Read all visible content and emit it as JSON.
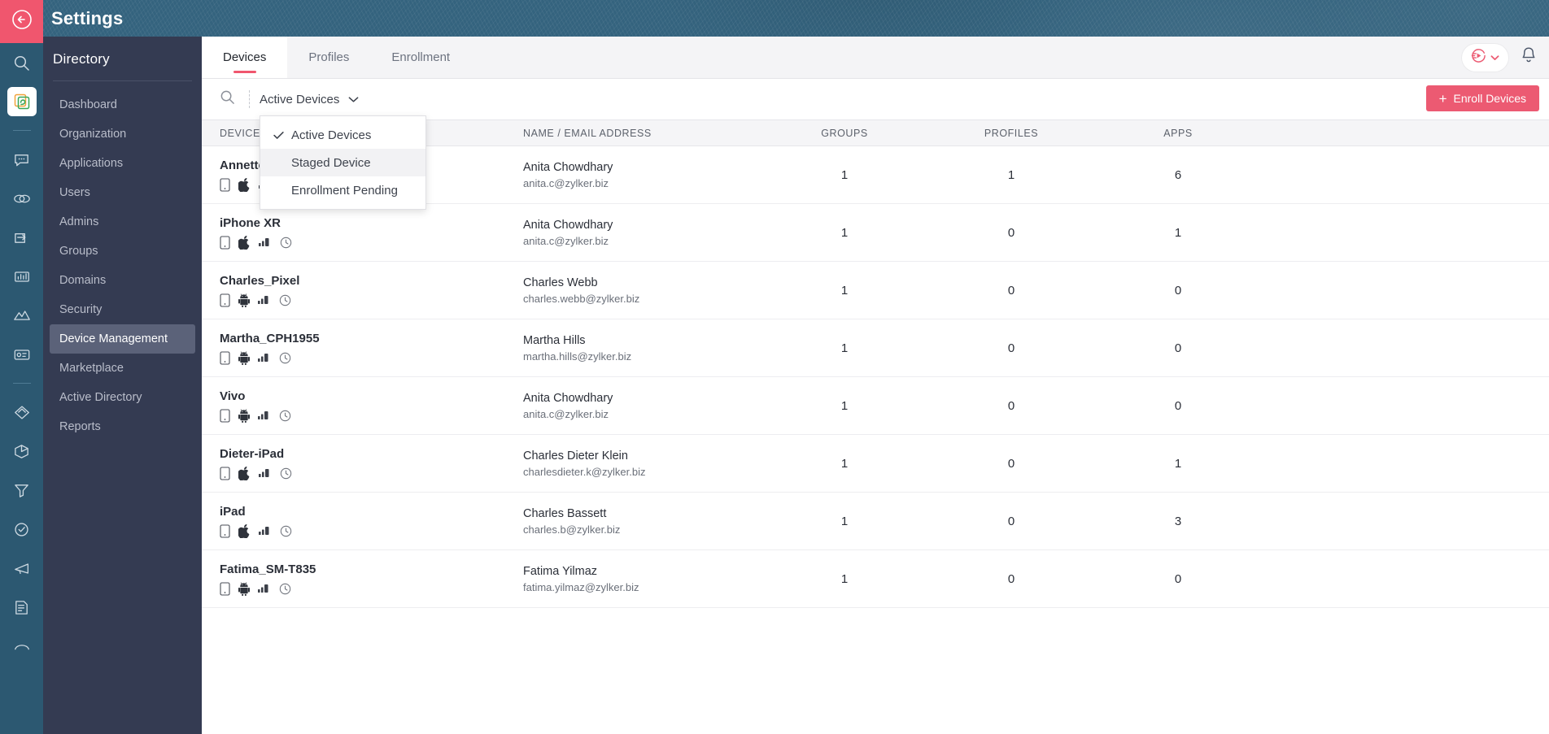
{
  "header": {
    "title": "Settings",
    "back_icon": "back-arrow-icon"
  },
  "rail": {
    "items": [
      {
        "name": "search-icon"
      },
      {
        "name": "app-logo-icon"
      },
      {
        "name": "chat-icon"
      },
      {
        "name": "links-icon"
      },
      {
        "name": "mail-send-icon"
      },
      {
        "name": "analytics-icon"
      },
      {
        "name": "chart-icon"
      },
      {
        "name": "payroll-icon"
      },
      {
        "name": "diamond-icon"
      },
      {
        "name": "box-icon"
      },
      {
        "name": "funnel-icon"
      },
      {
        "name": "clock-check-icon"
      },
      {
        "name": "campaign-icon"
      },
      {
        "name": "notes-icon"
      },
      {
        "name": "desk-icon"
      }
    ]
  },
  "sidebar": {
    "title": "Directory",
    "items": [
      {
        "label": "Dashboard",
        "active": false
      },
      {
        "label": "Organization",
        "active": false
      },
      {
        "label": "Applications",
        "active": false
      },
      {
        "label": "Users",
        "active": false
      },
      {
        "label": "Admins",
        "active": false
      },
      {
        "label": "Groups",
        "active": false
      },
      {
        "label": "Domains",
        "active": false
      },
      {
        "label": "Security",
        "active": false
      },
      {
        "label": "Device Management",
        "active": true
      },
      {
        "label": "Marketplace",
        "active": false
      },
      {
        "label": "Active Directory",
        "active": false
      },
      {
        "label": "Reports",
        "active": false
      }
    ]
  },
  "tabs": [
    {
      "label": "Devices",
      "active": true
    },
    {
      "label": "Profiles",
      "active": false
    },
    {
      "label": "Enrollment",
      "active": false
    }
  ],
  "topbar_actions": {
    "video_pill_icon": "video-play-icon",
    "video_pill_chevron": "chevron-down-icon",
    "bell_icon": "bell-icon"
  },
  "filterbar": {
    "search_icon": "search-icon",
    "selected_filter": "Active Devices",
    "chevron_icon": "chevron-down-icon",
    "enroll_button": "Enroll Devices",
    "enroll_plus": "+"
  },
  "dropdown": {
    "open": true,
    "items": [
      {
        "label": "Active Devices",
        "checked": true,
        "hover": false
      },
      {
        "label": "Staged Device",
        "checked": false,
        "hover": true
      },
      {
        "label": "Enrollment Pending",
        "checked": false,
        "hover": false
      }
    ]
  },
  "table": {
    "columns": [
      "DEVICE",
      "NAME / EMAIL ADDRESS",
      "GROUPS",
      "PROFILES",
      "APPS"
    ],
    "rows": [
      {
        "device": "Annette_iPhone",
        "platform": "apple",
        "user_name": "Anita Chowdhary",
        "user_email": "anita.c@zylker.biz",
        "groups": "1",
        "profiles": "1",
        "apps": "6"
      },
      {
        "device": "iPhone XR",
        "platform": "apple",
        "user_name": "Anita Chowdhary",
        "user_email": "anita.c@zylker.biz",
        "groups": "1",
        "profiles": "0",
        "apps": "1"
      },
      {
        "device": "Charles_Pixel",
        "platform": "android",
        "user_name": "Charles Webb",
        "user_email": "charles.webb@zylker.biz",
        "groups": "1",
        "profiles": "0",
        "apps": "0"
      },
      {
        "device": "Martha_CPH1955",
        "platform": "android",
        "user_name": "Martha Hills",
        "user_email": "martha.hills@zylker.biz",
        "groups": "1",
        "profiles": "0",
        "apps": "0"
      },
      {
        "device": "Vivo",
        "platform": "android",
        "user_name": "Anita Chowdhary",
        "user_email": "anita.c@zylker.biz",
        "groups": "1",
        "profiles": "0",
        "apps": "0"
      },
      {
        "device": "Dieter-iPad",
        "platform": "apple",
        "user_name": "Charles Dieter Klein",
        "user_email": "charlesdieter.k@zylker.biz",
        "groups": "1",
        "profiles": "0",
        "apps": "1"
      },
      {
        "device": "iPad",
        "platform": "apple",
        "user_name": "Charles Bassett",
        "user_email": "charles.b@zylker.biz",
        "groups": "1",
        "profiles": "0",
        "apps": "3"
      },
      {
        "device": "Fatima_SM-T835",
        "platform": "android",
        "user_name": "Fatima Yilmaz",
        "user_email": "fatima.yilmaz@zylker.biz",
        "groups": "1",
        "profiles": "0",
        "apps": "0"
      }
    ]
  },
  "colors": {
    "accent_pink": "#ec5a72",
    "header_blue": "#34637e",
    "rail_blue": "#2c5871",
    "sidebar_navy": "#343b52",
    "sidebar_active": "#5b6279"
  }
}
